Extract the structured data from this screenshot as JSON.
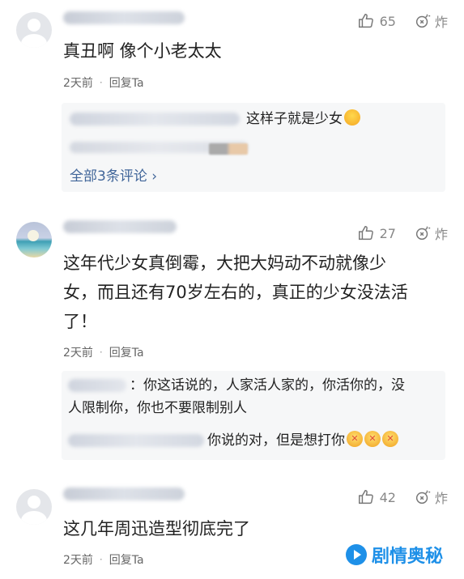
{
  "comments": [
    {
      "likes": "65",
      "report": "炸",
      "text": "真丑啊  像个小老太太",
      "time": "2天前",
      "dot": "·",
      "reply": "回复Ta",
      "replies": [
        {
          "text": "这样子就是少女"
        }
      ],
      "more": "全部3条评论 ›"
    },
    {
      "likes": "27",
      "report": "炸",
      "text_lines": [
        "这年代少女真倒霉，大把大妈动不动就像少",
        "女，而且还有70岁左右的，真正的少女没法活",
        "了！"
      ],
      "time": "2天前",
      "dot": "·",
      "reply": "回复Ta",
      "replies": [
        {
          "lines": [
            "：你这话说的，人家活人家的，你活你的，没",
            "人限制你，你也不要限制别人"
          ]
        },
        {
          "text": "你说的对，但是想打你"
        }
      ]
    },
    {
      "likes": "42",
      "report": "炸",
      "text": "这几年周迅造型彻底完了",
      "time": "2天前",
      "dot": "·",
      "reply": "回复Ta"
    }
  ],
  "watermark": "剧情奥秘",
  "icons": [
    "thumb-up-icon",
    "bomb-icon",
    "laugh-emoji-icon",
    "angry-emoji-icon",
    "play-logo-icon"
  ],
  "colors": {
    "link": "#406599",
    "watermark": "#1e90e8",
    "reply_bg": "#f6f7f8"
  }
}
